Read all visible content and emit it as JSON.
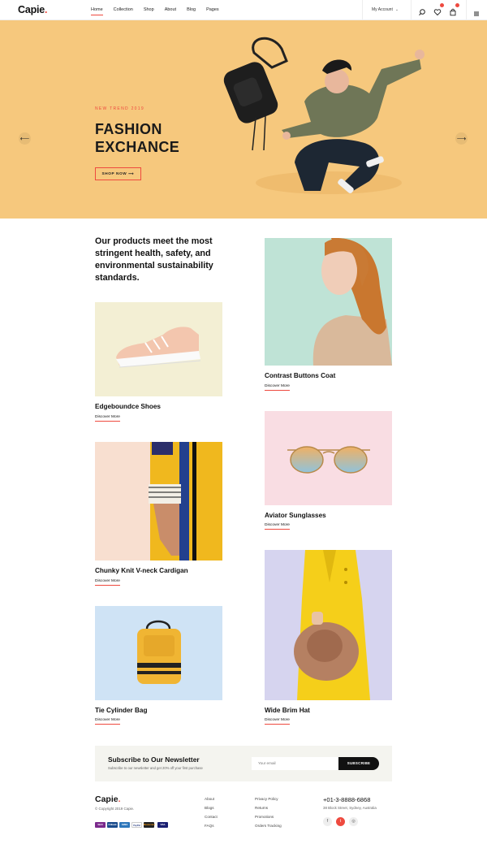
{
  "header": {
    "logo": "Capie",
    "logo_dot": ".",
    "nav": [
      {
        "label": "Home",
        "active": true
      },
      {
        "label": "Collection",
        "active": false
      },
      {
        "label": "Shop",
        "active": false
      },
      {
        "label": "About",
        "active": false
      },
      {
        "label": "Blog",
        "active": false
      },
      {
        "label": "Pages",
        "active": false
      }
    ],
    "account_label": "My Account",
    "icons": [
      "search-icon",
      "wishlist-icon",
      "cart-icon",
      "menu-icon"
    ]
  },
  "hero": {
    "tag": "NEW TREND 2019",
    "title_line1": "FASHION",
    "title_line2": "EXCHANCE",
    "button_label": "SHOP NOW ⟶",
    "prev_arrow": "⟵",
    "next_arrow": "⟶",
    "background": "#f6c87d"
  },
  "intro": {
    "text": "Our products meet the most stringent health, safety, and environmental sustainability standards."
  },
  "products": [
    {
      "title": "Edgeboundce Shoes",
      "link": "Discover More",
      "bg": "#f3efd4"
    },
    {
      "title": "Chunky Knit V-neck Cardigan",
      "link": "Discover More",
      "bg": "#f8dfd0"
    },
    {
      "title": "Tie Cylinder Bag",
      "link": "Discover More",
      "bg": "#cfe3f5"
    },
    {
      "title": "Contrast Buttons Coat",
      "link": "Discover More",
      "bg": "#bfe3d6"
    },
    {
      "title": "Aviator Sunglasses",
      "link": "Discover More",
      "bg": "#f9dde3"
    },
    {
      "title": "Wide Brim Hat",
      "link": "Discover More",
      "bg": "#d6d4ef"
    }
  ],
  "newsletter": {
    "title": "Subscribe to Our Newsletter",
    "subtitle": "Subscribe to our newsletter and get 20% off your first purchase",
    "placeholder": "Your email",
    "button": "SUBSCRIBE"
  },
  "footer": {
    "logo": "Capie",
    "logo_dot": ".",
    "copyright": "© Copyright 2019 Capie.",
    "payments": [
      "Skrill",
      "Citibank",
      "AMEX",
      "PayPal",
      "Mastercard",
      "VISA"
    ],
    "links_col1": [
      "About",
      "Blogs",
      "Contact",
      "FAQs"
    ],
    "links_col2": [
      "Privacy Policy",
      "Returns",
      "Promotions",
      "Orders Tracking"
    ],
    "phone": "+01-3-8888-6868",
    "address": "38 Block Street, Sydney, Australia",
    "social": [
      "f",
      "t",
      "◎"
    ]
  },
  "colors": {
    "accent": "#ee4a3f",
    "text": "#111111"
  }
}
